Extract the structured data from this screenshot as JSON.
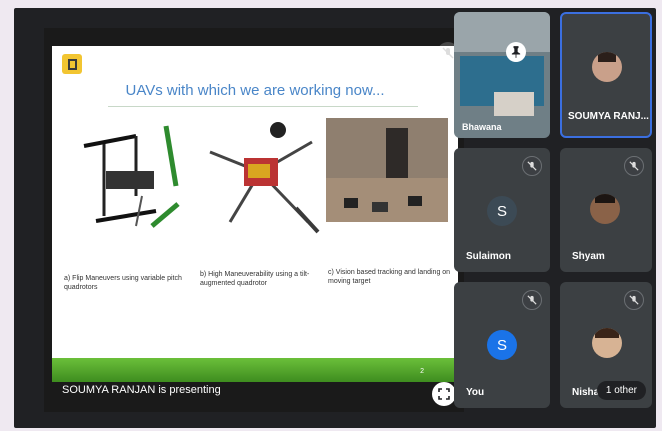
{
  "slide": {
    "title": "UAVs with which we are working now...",
    "captions": [
      "a) Flip Maneuvers using variable pitch quadrotors",
      "b) High Maneuverability using a tilt-augmented quadrotor",
      "c) Vision based tracking and landing on moving target"
    ],
    "page_number": "2"
  },
  "presenting_label": "SOUMYA RANJAN is presenting",
  "participants": [
    {
      "name": "Bhawana",
      "kind": "video",
      "muted": false,
      "pinned": true
    },
    {
      "name": "SOUMYA RANJ...",
      "kind": "video",
      "muted": false,
      "pinned": false
    },
    {
      "name": "Sulaimon",
      "kind": "initial",
      "initial": "S",
      "avatar_color": "#3c4a55",
      "muted": true
    },
    {
      "name": "Shyam",
      "kind": "photo",
      "muted": true
    },
    {
      "name": "You",
      "kind": "initial",
      "initial": "S",
      "avatar_color": "#1a73e8",
      "muted": true
    },
    {
      "name": "Nisha",
      "kind": "photo",
      "muted": true
    }
  ],
  "others_chip": "1 other",
  "colors": {
    "accent_blue": "#1a73e8",
    "tile_bg": "#3c4043",
    "slide_footer": "#4fa22a"
  },
  "icons": [
    "slide-logo-icon",
    "pin-icon",
    "mic-off-icon",
    "fullscreen-icon"
  ]
}
